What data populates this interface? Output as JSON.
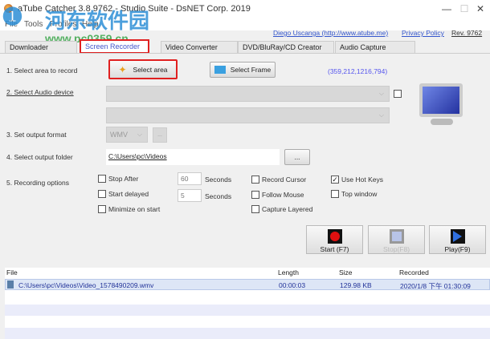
{
  "window": {
    "title": "aTube Catcher 3.8.9762 - Studio Suite - DsNET Corp. 2019",
    "minimize": "—",
    "maximize": "☐",
    "close": "✕"
  },
  "menu": [
    "File",
    "Tools",
    "Profiles",
    "Help"
  ],
  "links": {
    "author": "Diego Uscanga (http://www.atube.me)",
    "privacy": "Privacy Policy",
    "rev": "Rev. 9762"
  },
  "tabs": [
    "Downloader",
    "Screen Recorder",
    "Video Converter",
    "DVD/BluRay/CD Creator",
    "Audio Capture"
  ],
  "recorder": {
    "step1": "1. Select area to record",
    "select_area": "Select area",
    "select_frame": "Select Frame",
    "coords": "(359,212,1216,794)",
    "step2": "2. Select Audio device",
    "step3": "3. Set output format",
    "format": "WMV",
    "format_more": "...",
    "step4": "4. Select output folder",
    "folder": "C:\\Users\\pc\\Videos",
    "browse": "...",
    "step5": "5. Recording options",
    "stop_after": "Stop After",
    "stop_after_value": "60",
    "seconds": "Seconds",
    "start_delayed": "Start delayed",
    "start_delayed_value": "5",
    "minimize": "Minimize on start",
    "record_cursor": "Record Cursor",
    "follow_mouse": "Follow Mouse",
    "capture_layered": "Capture Layered",
    "hot_keys": "Use Hot Keys",
    "hot_keys_check": "✓",
    "top_window": "Top window",
    "start": "Start (F7)",
    "stop": "Stop(F8)",
    "play": "Play(F9)"
  },
  "list": {
    "headers": [
      "File",
      "Length",
      "Size",
      "Recorded"
    ],
    "rows": [
      {
        "file": "C:\\Users\\pc\\Videos\\Video_1578490209.wmv",
        "length": "00:00:03",
        "size": "129.98 KB",
        "recorded": "2020/1/8 下午 01:30:09"
      }
    ]
  },
  "watermark": {
    "name": "河东软件园",
    "url": "www.pc0359.cn"
  },
  "colors": {
    "accent": "#3355cc",
    "highlight": "#e02020",
    "selected_row": "#dde6f6"
  }
}
